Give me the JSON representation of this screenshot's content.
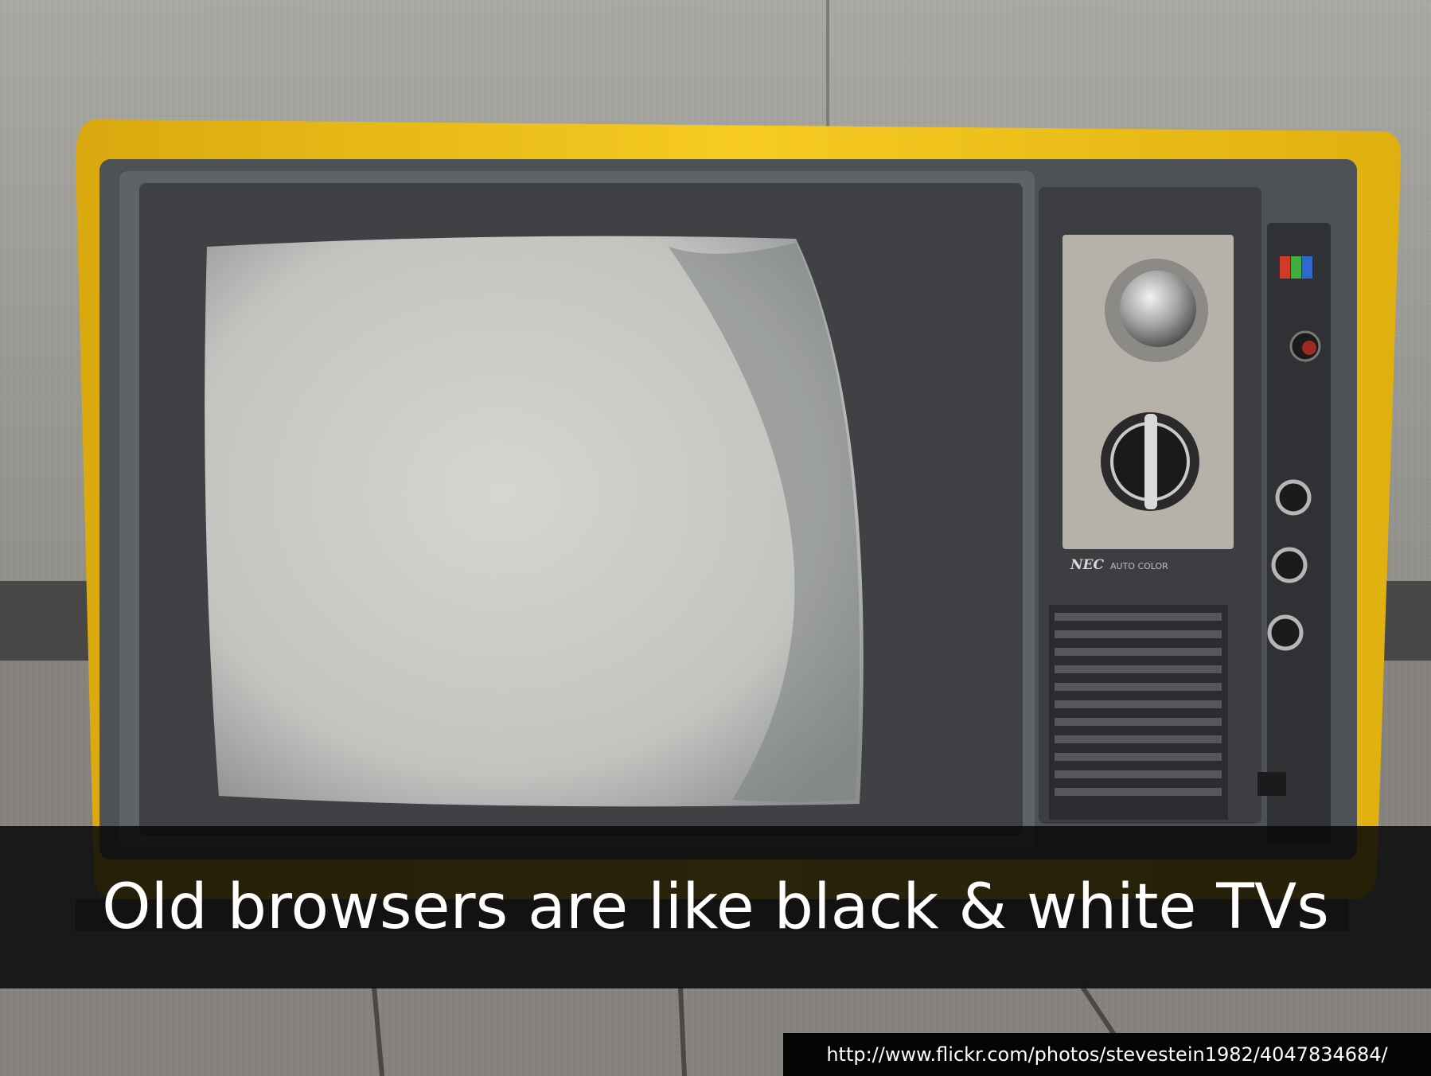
{
  "slide": {
    "caption": "Old browsers are like black & white TVs",
    "credit_url": "http://www.flickr.com/photos/stevestein1982/4047834684/"
  },
  "photo": {
    "brand_label": "NEC AUTO COLOR",
    "colors": {
      "cabinet": "#f2c21a",
      "bezel": "#5b5e63",
      "screen": "#c6c8c4",
      "wall": "#9b9a95",
      "pavement": "#86837e",
      "caption_bar": "#0a0a0a"
    }
  }
}
